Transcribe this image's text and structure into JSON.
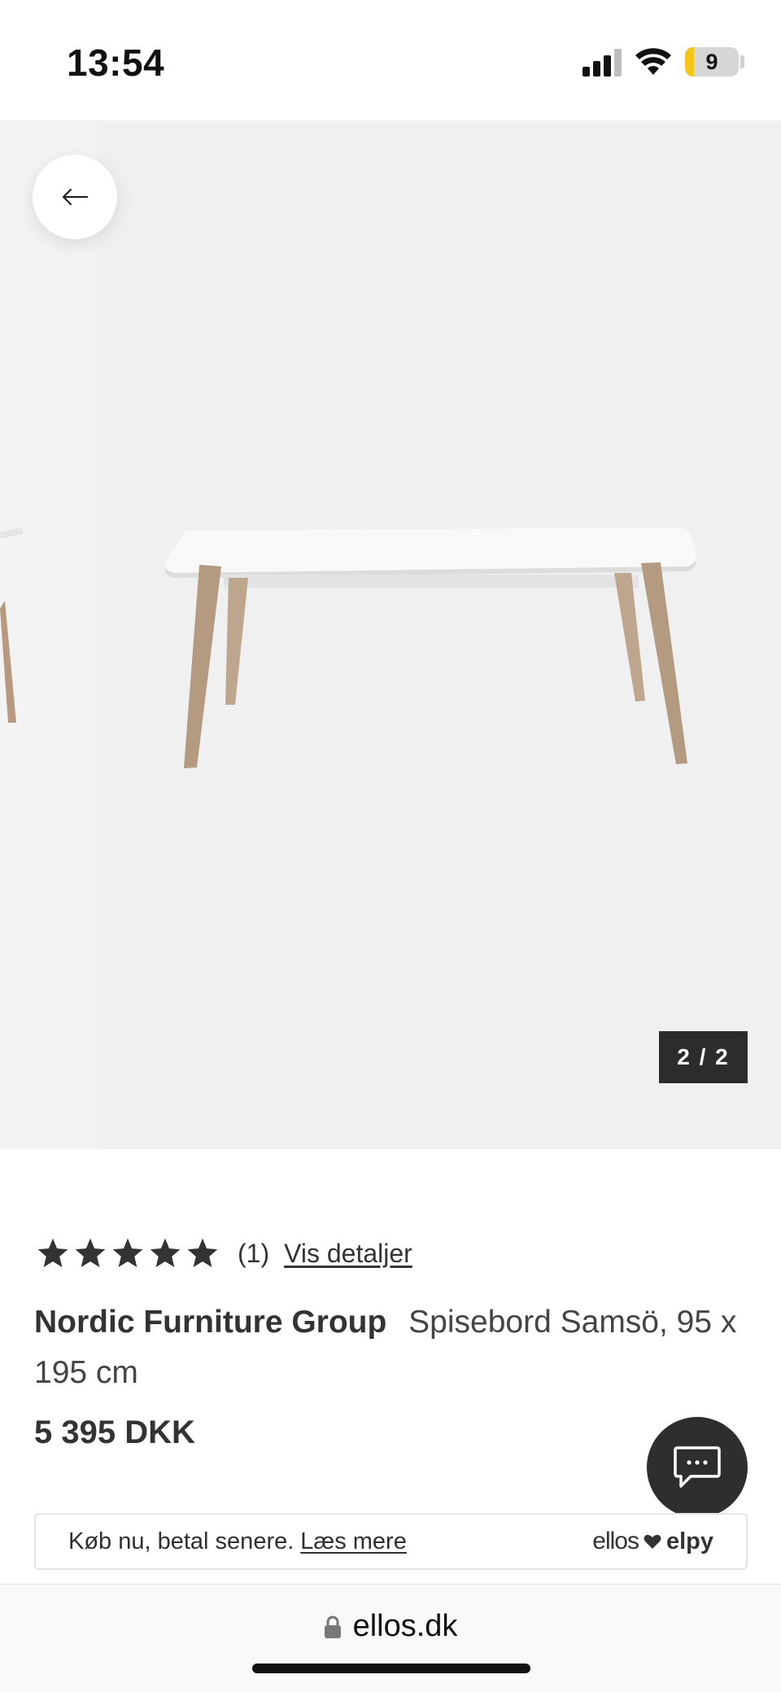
{
  "status_bar": {
    "time": "13:54",
    "battery_level": "9",
    "battery_fraction": 0.09,
    "battery_color": "#f5c518",
    "signal_icon": "cellular-signal-icon",
    "wifi_icon": "wifi-icon"
  },
  "gallery": {
    "back_icon": "arrow-left-icon",
    "counter": "2 / 2",
    "image": "white dining table with oak legs"
  },
  "product": {
    "rating_stars": 5,
    "review_count": "(1)",
    "details_link": "Vis detaljer",
    "brand": "Nordic Furniture Group",
    "name": "Spisebord Samsö, 95 x 195 cm",
    "price": "5 395 DKK"
  },
  "bnpl": {
    "text": "Køb nu, betal senere.",
    "link": "Læs mere",
    "logo_left": "ellos",
    "logo_right": "elpy",
    "heart_icon": "heart-icon"
  },
  "chat": {
    "icon": "chat-bubble-icon"
  },
  "browser": {
    "url": "ellos.dk",
    "lock_icon": "lock-icon"
  },
  "colors": {
    "dark": "#2c2c2c",
    "gallery_bg": "#f1f0f1",
    "star": "#333333"
  }
}
